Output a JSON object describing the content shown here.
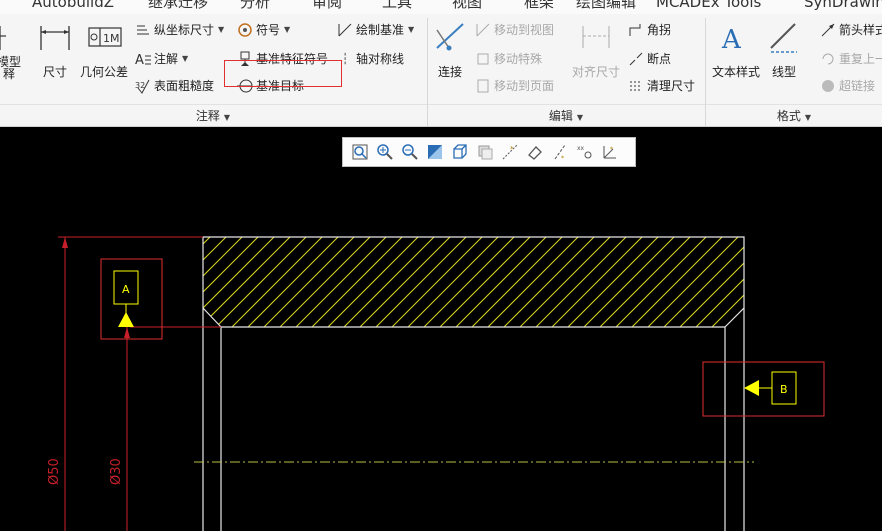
{
  "tabs": [
    "AutobuildZ",
    "继承迁移",
    "分析",
    "审阅",
    "工具",
    "视图",
    "框架",
    "绘图编辑",
    "MCADEx Tools",
    "SynDrawin"
  ],
  "ribbon": {
    "annotation": {
      "model_label_line1": "模型",
      "model_label_line2": "释",
      "dimension": "尺寸",
      "gtol": "几何公差",
      "ordinate_dim": "纵坐标尺寸",
      "note": "注解",
      "surface_finish": "表面粗糙度",
      "symbol": "符号",
      "datum_feature_symbol": "基准特征符号",
      "datum_target": "基准目标",
      "sketch_datum": "绘制基准",
      "axis_symmetry": "轴对称线",
      "footer": "注释"
    },
    "edit": {
      "connect": "连接",
      "move_to_view": "移动到视图",
      "move_special": "移动特殊",
      "move_to_page": "移动到页面",
      "align_dimension": "对齐尺寸",
      "corner": "角拐",
      "breakpoint": "断点",
      "clean_dimension": "清理尺寸",
      "footer": "编辑"
    },
    "format": {
      "text_style": "文本样式",
      "line_type": "线型",
      "arrow_style": "箭头样式",
      "repeat_last": "重复上一",
      "hyperlink": "超链接",
      "footer": "格式"
    }
  },
  "dimension_labels": {
    "outer_diameter": "Ø50",
    "inner_diameter": "Ø30"
  },
  "datums": {
    "a": "A",
    "b": "B"
  },
  "colors": {
    "datum_yellow": "#ffff00",
    "dim_red": "#c8202a",
    "hatch_yellow": "#d8d820",
    "geometry_white": "#e8e8e8",
    "centerline": "#b8c040",
    "callout_red": "#e03030"
  }
}
